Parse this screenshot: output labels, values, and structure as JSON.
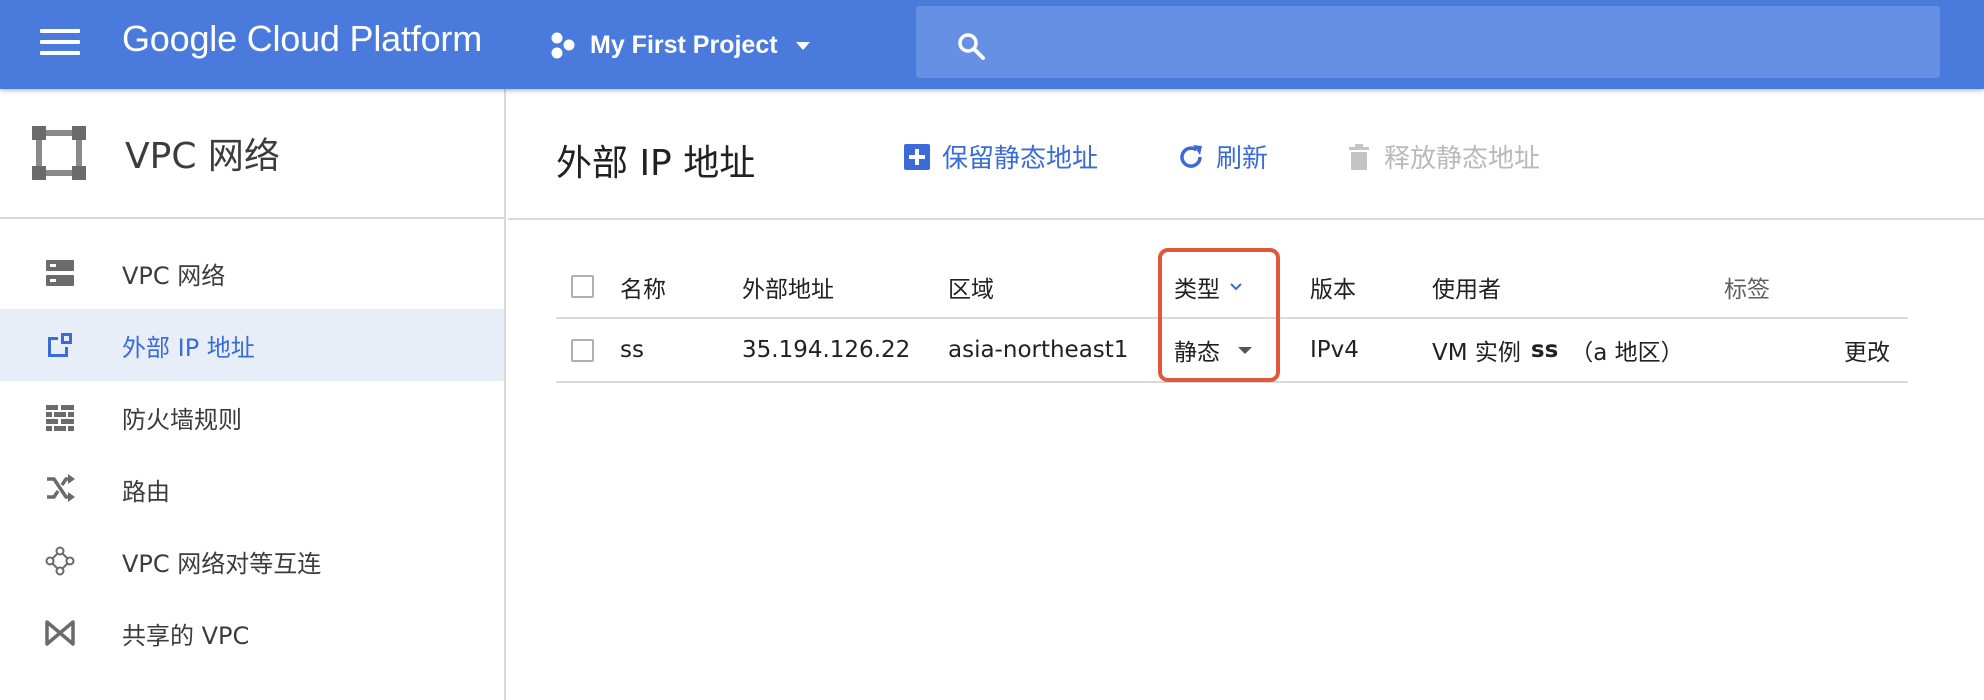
{
  "appbar": {
    "brand": "Google Cloud Platform",
    "project": "My First Project",
    "search_placeholder": ""
  },
  "sidebar": {
    "product": "VPC 网络",
    "items": [
      {
        "label": "VPC 网络",
        "icon": "vpc-network-icon",
        "active": false
      },
      {
        "label": "外部 IP 地址",
        "icon": "external-ip-icon",
        "active": true
      },
      {
        "label": "防火墙规则",
        "icon": "firewall-icon",
        "active": false
      },
      {
        "label": "路由",
        "icon": "routes-icon",
        "active": false
      },
      {
        "label": "VPC 网络对等互连",
        "icon": "peering-icon",
        "active": false
      },
      {
        "label": "共享的 VPC",
        "icon": "shared-vpc-icon",
        "active": false
      }
    ]
  },
  "main": {
    "title": "外部 IP 地址",
    "actions": {
      "reserve": "保留静态地址",
      "refresh": "刷新",
      "release": "释放静态地址"
    }
  },
  "table": {
    "headers": {
      "name": "名称",
      "address": "外部地址",
      "region": "区域",
      "type": "类型",
      "version": "版本",
      "user": "使用者",
      "labels": "标签"
    },
    "rows": [
      {
        "name": "ss",
        "address": "35.194.126.22",
        "region": "asia-northeast1",
        "type": "静态",
        "version": "IPv4",
        "user_prefix": "VM 实例",
        "user_name": "ss",
        "user_region": "（a 地区）",
        "action": "更改"
      }
    ]
  },
  "colors": {
    "appbar": "#4a7bdc",
    "accent": "#3b6bd6",
    "highlight": "#e2563a",
    "disabled": "#b9b9b9"
  }
}
